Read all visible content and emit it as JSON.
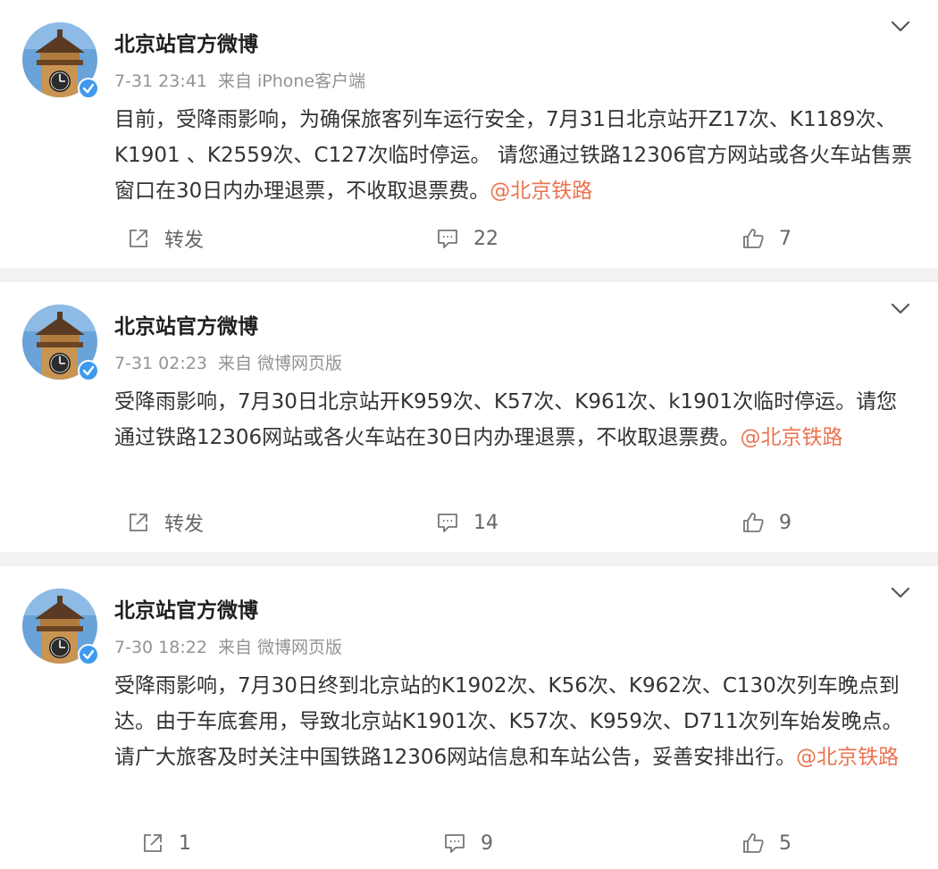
{
  "posts": [
    {
      "author": "北京站官方微博",
      "time": "7-31 23:41",
      "via": "来自",
      "source": "iPhone客户端",
      "text": "目前，受降雨影响，为确保旅客列车运行安全，7月31日北京站开Z17次、K1189次、K1901 、K2559次、C127次临时停运。 请您通过铁路12306官方网站或各火车站售票窗口在30日内办理退票，不收取退票费。",
      "mention": "@北京铁路",
      "repost_label": "转发",
      "comments": "22",
      "likes": "7"
    },
    {
      "author": "北京站官方微博",
      "time": "7-31 02:23",
      "via": "来自",
      "source": "微博网页版",
      "text": "受降雨影响，7月30日北京站开K959次、K57次、K961次、k1901次临时停运。请您通过铁路12306网站或各火车站在30日内办理退票，不收取退票费。",
      "mention": "@北京铁路",
      "repost_label": "转发",
      "comments": "14",
      "likes": "9"
    },
    {
      "author": "北京站官方微博",
      "time": "7-30 18:22",
      "via": "来自",
      "source": "微博网页版",
      "text": "受降雨影响，7月30日终到北京站的K1902次、K56次、K962次、C130次列车晚点到达。由于车底套用，导致北京站K1901次、K57次、K959次、D711次列车始发晚点。请广大旅客及时关注中国铁路12306网站信息和车站公告，妥善安排出行。",
      "mention": "@北京铁路",
      "repost_label": "1",
      "comments": "9",
      "likes": "5"
    }
  ],
  "icons": {
    "repost": "share-arrow-icon",
    "comment": "comment-bubble-icon",
    "like": "thumbs-up-icon",
    "more": "chevron-down-icon",
    "verified": "verified-badge-icon"
  },
  "colors": {
    "mention": "#eb7350",
    "verified": "#3f9aef",
    "separator": "#f2f2f3"
  }
}
